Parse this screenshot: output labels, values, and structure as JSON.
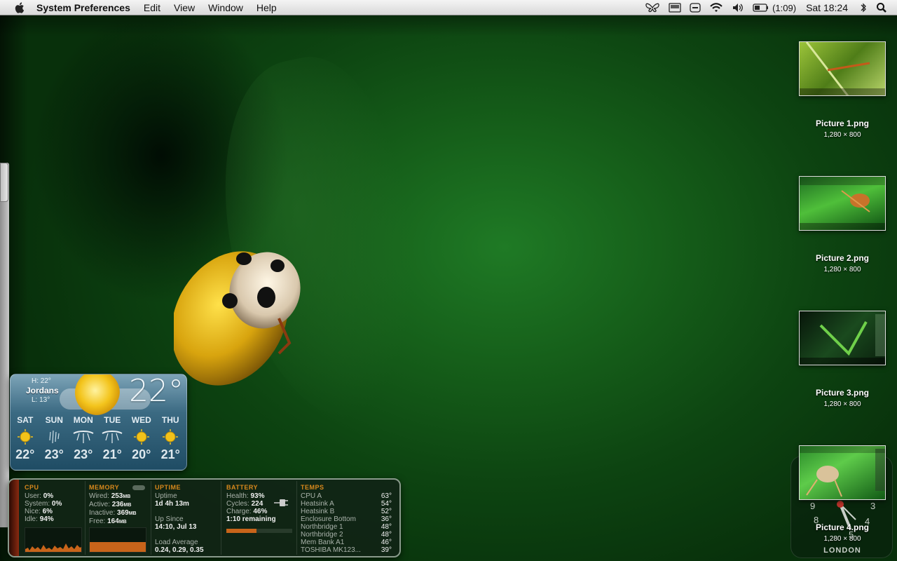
{
  "menubar": {
    "app_name": "System Preferences",
    "menus": [
      "Edit",
      "View",
      "Window",
      "Help"
    ],
    "battery_text": "(1:09)",
    "clock": "Sat 18:24"
  },
  "desktop_files": [
    {
      "name": "Picture 1.png",
      "dims": "1,280 × 800"
    },
    {
      "name": "Picture 2.png",
      "dims": "1,280 × 800"
    },
    {
      "name": "Picture 3.png",
      "dims": "1,280 × 800"
    },
    {
      "name": "Picture 4.png",
      "dims": "1,280 × 800"
    }
  ],
  "weather": {
    "high": "H: 22°",
    "city": "Jordans",
    "low": "L: 13°",
    "current_temp": "22°",
    "forecast": [
      {
        "day": "SAT",
        "temp": "22°",
        "icon": "sun-icon"
      },
      {
        "day": "SUN",
        "temp": "23°",
        "icon": "rain-icon"
      },
      {
        "day": "MON",
        "temp": "23°",
        "icon": "storm-icon"
      },
      {
        "day": "TUE",
        "temp": "21°",
        "icon": "storm-icon"
      },
      {
        "day": "WED",
        "temp": "20°",
        "icon": "sun-icon"
      },
      {
        "day": "THU",
        "temp": "21°",
        "icon": "sun-icon"
      }
    ]
  },
  "istat": {
    "cpu": {
      "title": "CPU",
      "rows": [
        {
          "label": "User:",
          "value": "0%"
        },
        {
          "label": "System:",
          "value": "0%"
        },
        {
          "label": "Nice:",
          "value": "6%"
        },
        {
          "label": "Idle:",
          "value": "94%"
        }
      ]
    },
    "memory": {
      "title": "MEMORY",
      "rows": [
        {
          "label": "Wired:",
          "value": "253",
          "unit": "MB"
        },
        {
          "label": "Active:",
          "value": "236",
          "unit": "MB"
        },
        {
          "label": "Inactive:",
          "value": "369",
          "unit": "MB"
        },
        {
          "label": "Free:",
          "value": "164",
          "unit": "MB"
        }
      ]
    },
    "uptime": {
      "title": "UPTIME",
      "uptime_label": "Uptime",
      "uptime_value": "1d 4h 13m",
      "since_label": "Up Since",
      "since_value": "14:10, Jul 13",
      "load_label": "Load Average",
      "load_value": "0.24, 0.29, 0.35"
    },
    "battery": {
      "title": "BATTERY",
      "health_label": "Health:",
      "health_value": "93%",
      "cycles_label": "Cycles:",
      "cycles_value": "224",
      "charge_label": "Charge:",
      "charge_value": "46%",
      "remaining": "1:10 remaining",
      "charge_fraction": 0.46
    },
    "temps": {
      "title": "TEMPS",
      "rows": [
        {
          "label": "CPU A",
          "value": "63°"
        },
        {
          "label": "Heatsink A",
          "value": "54°"
        },
        {
          "label": "Heatsink B",
          "value": "52°"
        },
        {
          "label": "Enclosure Bottom",
          "value": "36°"
        },
        {
          "label": "Northbridge 1",
          "value": "48°"
        },
        {
          "label": "Northbridge 2",
          "value": "48°"
        },
        {
          "label": "Mem Bank A1",
          "value": "46°"
        },
        {
          "label": "TOSHIBA MK123...",
          "value": "39°"
        }
      ]
    }
  },
  "world_clock": {
    "city": "LONDON",
    "numerals": [
      "9",
      "3",
      "8",
      "4",
      "5"
    ]
  },
  "colors": {
    "menubar": "#e6e6e6",
    "wallpaper": "#155d19",
    "istat_accent": "#d9891c",
    "battery_fill": "#c8641a"
  }
}
